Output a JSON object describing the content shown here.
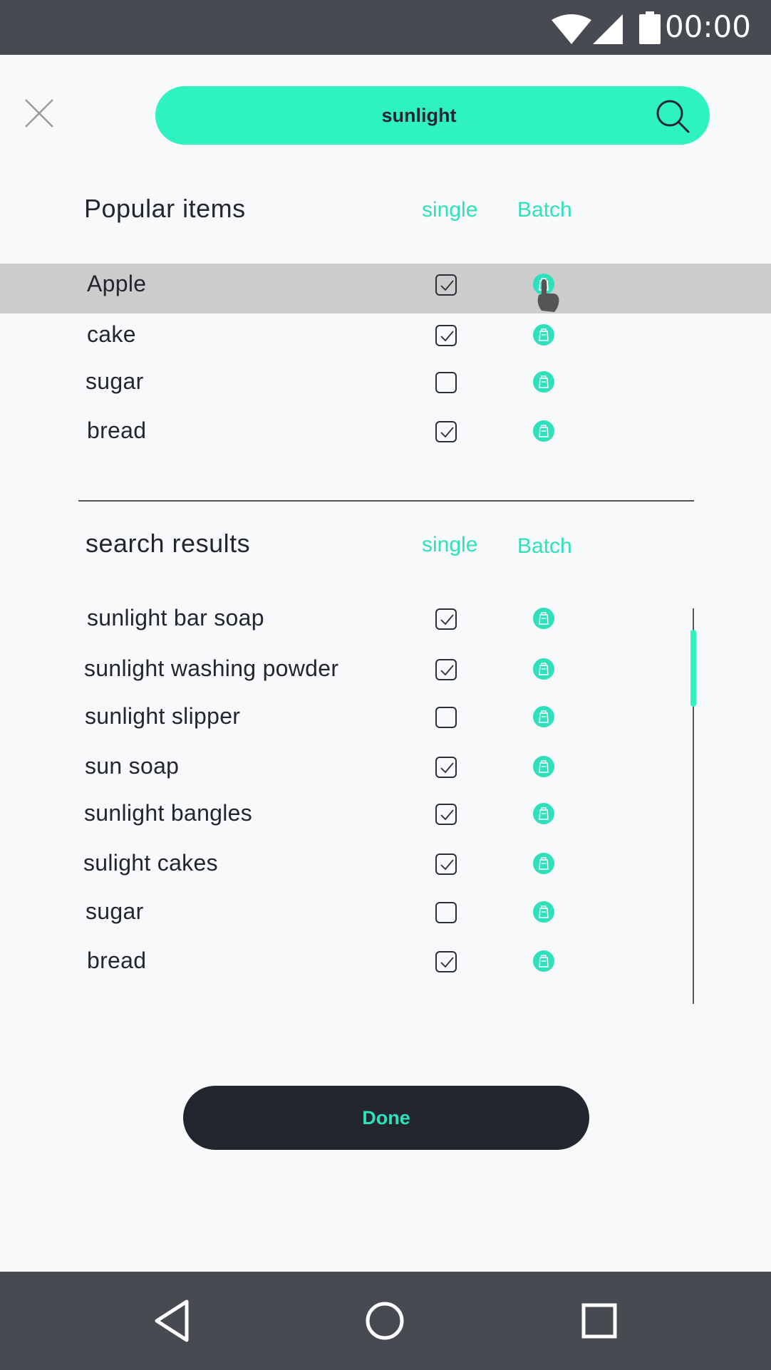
{
  "status_bar": {
    "time": "00:00"
  },
  "search": {
    "query": "sunlight"
  },
  "popular": {
    "title": "Popular items",
    "col_single": "single",
    "col_batch": "Batch",
    "items": [
      {
        "label": "Apple",
        "single": true
      },
      {
        "label": "cake",
        "single": true
      },
      {
        "label": "sugar",
        "single": false
      },
      {
        "label": "bread",
        "single": true
      }
    ]
  },
  "results": {
    "title": "search results",
    "col_single": "single",
    "col_batch": "Batch",
    "items": [
      {
        "label": "sunlight bar soap",
        "single": true
      },
      {
        "label": "sunlight washing powder",
        "single": true
      },
      {
        "label": "sunlight slipper",
        "single": false
      },
      {
        "label": "sun soap",
        "single": true
      },
      {
        "label": "sunlight bangles",
        "single": true
      },
      {
        "label": "sulight cakes",
        "single": true
      },
      {
        "label": "sugar",
        "single": false
      },
      {
        "label": "bread",
        "single": true
      }
    ]
  },
  "done_label": "Done",
  "colors": {
    "accent": "#2ef2c0",
    "dark": "#23262e",
    "highlight": "#cccccc"
  }
}
